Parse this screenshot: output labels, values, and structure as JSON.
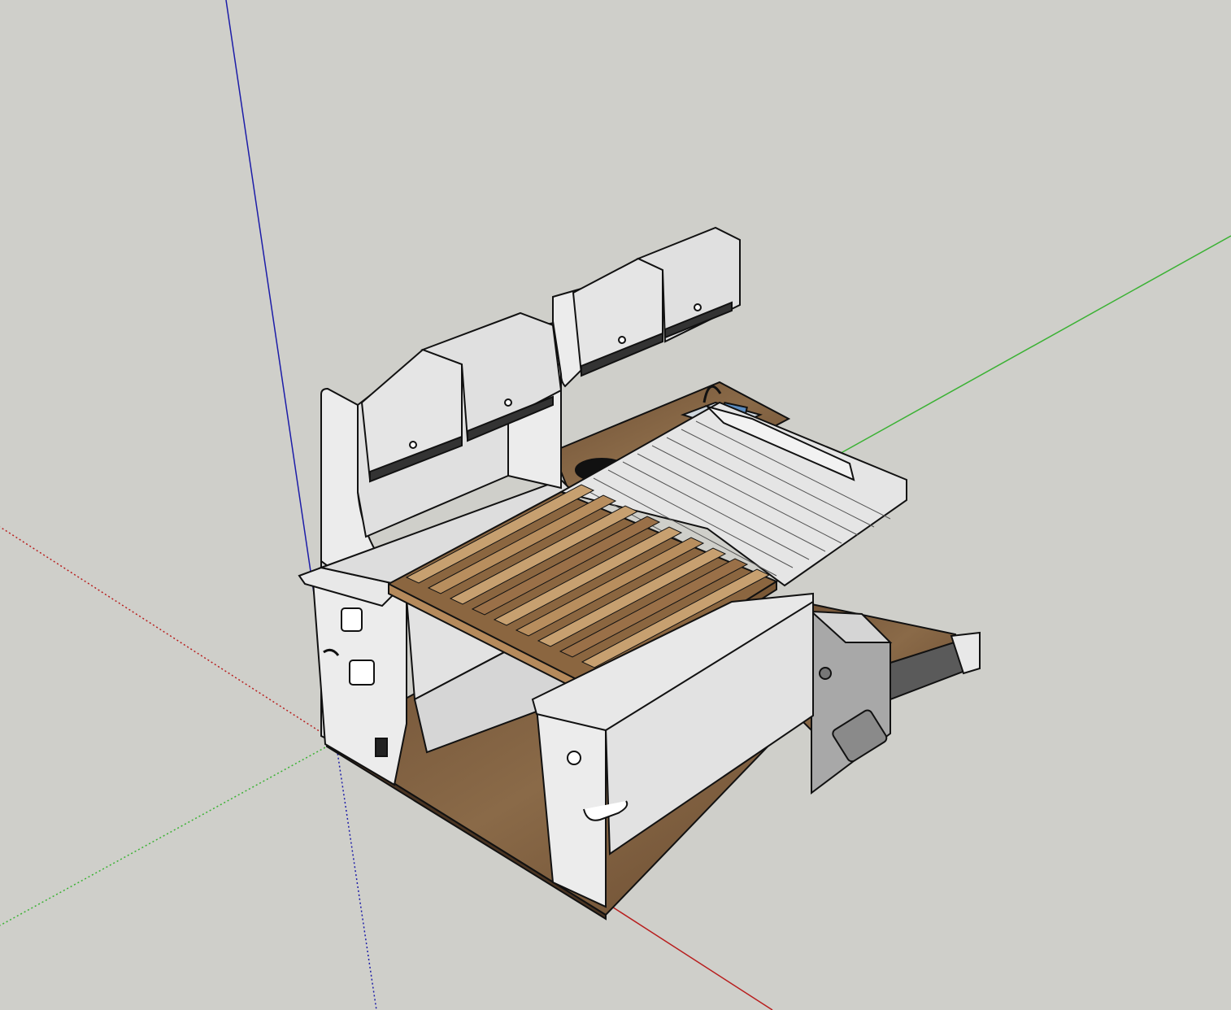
{
  "app": {
    "background_color": "#cfcfca"
  },
  "axes": {
    "red_color": "#b81e1e",
    "green_color": "#3bb234",
    "blue_color": "#1c1ca8"
  },
  "model": {
    "panel_color": "#ececec",
    "panel_shade_color": "#d8d8d8",
    "wood_floor_color": "#7a5a3c",
    "wood_slat_light": "#c7a070",
    "wood_slat_dark": "#8b6640",
    "outline_color": "#111111",
    "drawer_grey": "#aaaaaa"
  }
}
